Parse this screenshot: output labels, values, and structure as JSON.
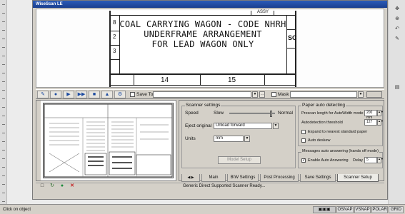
{
  "window": {
    "title": "WiseScan LE"
  },
  "drawing": {
    "title_lines": [
      "COAL CARRYING WAGON - CODE NHRH",
      "UNDERFRAME ARRANGEMENT",
      "FOR LEAD WAGON ONLY"
    ],
    "left_margin_marks": [
      "8",
      "2",
      "3"
    ],
    "right_mark": "SC",
    "top_mark": "ASSY",
    "bottom_numbers": [
      "14",
      "15"
    ]
  },
  "toolbar": {
    "save_to_label": "Save To",
    "save_to_value": "",
    "mask_label": "Mask",
    "mask_value": ""
  },
  "scanner_settings": {
    "group_title": "Scanner settings",
    "speed_label": "Speed",
    "speed_slow": "Slow",
    "speed_normal": "Normal",
    "speed_level": 0.95,
    "eject_label": "Eject original",
    "eject_value": "Unload forward",
    "units_label": "Units",
    "units_value": "mm",
    "model_setup_label": "Model Setup"
  },
  "paper_detect": {
    "group_title": "Paper auto detecting",
    "prescan_label": "Prescan length for AutoWidth mode",
    "prescan_value": "200 mm",
    "threshold_label": "Autodetection threshold",
    "threshold_value": "127",
    "expand_label": "Expand to nearest standard paper",
    "deskew_label": "Auto deskew"
  },
  "messages": {
    "group_title": "Messages auto answering (hands off mode)",
    "enable_label": "Enable Auto Answering",
    "delay_label": "Delay",
    "delay_value": "5"
  },
  "tabs": [
    "Main",
    "B\\W Settings",
    "Post Processing",
    "Save Settings",
    "Scanner Setup"
  ],
  "status_message": "Generic Direct Supported Scanner Ready...",
  "statusbar": {
    "left_text": "Click on object",
    "cells": [
      "OSNAP",
      "VSNAP",
      "POLAR",
      "GRID"
    ]
  }
}
